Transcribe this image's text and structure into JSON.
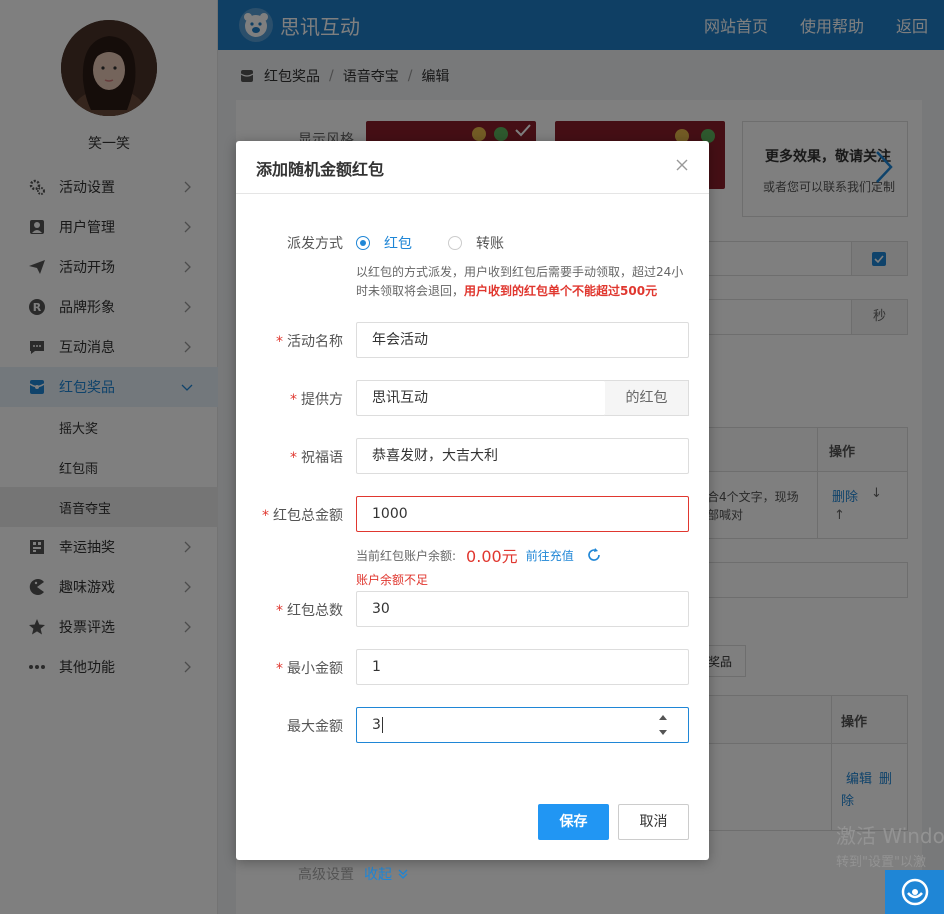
{
  "sidebar": {
    "username": "笑一笑",
    "menu": [
      {
        "label": "活动设置",
        "icon": "gear-icon"
      },
      {
        "label": "用户管理",
        "icon": "user-icon"
      },
      {
        "label": "活动开场",
        "icon": "paper-plane-icon"
      },
      {
        "label": "品牌形象",
        "icon": "registered-icon"
      },
      {
        "label": "互动消息",
        "icon": "chat-icon"
      },
      {
        "label": "红包奖品",
        "icon": "red-packet-icon",
        "open": true
      },
      {
        "label": "幸运抽奖",
        "icon": "lottery-icon"
      },
      {
        "label": "趣味游戏",
        "icon": "pacman-icon"
      },
      {
        "label": "投票评选",
        "icon": "star-icon"
      },
      {
        "label": "其他功能",
        "icon": "dots-icon"
      }
    ],
    "submenu": [
      {
        "label": "摇大奖"
      },
      {
        "label": "红包雨"
      },
      {
        "label": "语音夺宝",
        "active": true
      }
    ]
  },
  "topbar": {
    "brand": "思讯互动",
    "links": [
      "网站首页",
      "使用帮助",
      "返回"
    ],
    "color": "#1f7ec9"
  },
  "breadcrumb": [
    "红包奖品",
    "语音夺宝",
    "编辑"
  ],
  "background": {
    "style_label": "显示风格",
    "more_title": "更多效果，敬请关注",
    "more_sub": "或者您可以联系我们定制",
    "seconds_unit": "秒",
    "op_header_1": "操作",
    "op_links_1": [
      "删除",
      "↓",
      "↑"
    ],
    "desc_snippet_1": "合4个文字，现场",
    "desc_snippet_2": "部喊对",
    "prize_btn": "奖品",
    "op_header_2": "操作",
    "op_links_2": [
      "编辑",
      "删",
      "除"
    ],
    "advanced_label": "高级设置",
    "advanced_toggle": "收起"
  },
  "modal": {
    "title": "添加随机金额红包",
    "dispatch_label": "派发方式",
    "options": [
      {
        "label": "红包",
        "selected": true
      },
      {
        "label": "转账",
        "selected": false
      }
    ],
    "hint": "以红包的方式派发，用户收到红包后需要手动领取，超过24小时未领取将会退回，",
    "hint_warn": "用户收到的红包单个不能超过500元",
    "fields": {
      "name": {
        "label": "活动名称",
        "value": "年会活动",
        "required": true
      },
      "provider": {
        "label": "提供方",
        "value": "思讯互动",
        "addon": "的红包",
        "required": true
      },
      "blessing": {
        "label": "祝福语",
        "value": "恭喜发财，大吉大利",
        "required": true
      },
      "total_amount": {
        "label": "红包总金额",
        "value": "1000",
        "required": true
      },
      "total_count": {
        "label": "红包总数",
        "value": "30",
        "required": true
      },
      "min_amount": {
        "label": "最小金额",
        "value": "1",
        "required": true
      },
      "max_amount": {
        "label": "最大金额",
        "value": "3",
        "required": false
      }
    },
    "balance_label": "当前红包账户余额:",
    "balance_value": "0.00元",
    "recharge_link": "前往充值",
    "error": "账户余额不足",
    "save": "保存",
    "cancel": "取消",
    "required_mark": "*"
  },
  "watermark": {
    "line1": "激活 Windo",
    "line2": "转到\"设置\"以激"
  }
}
